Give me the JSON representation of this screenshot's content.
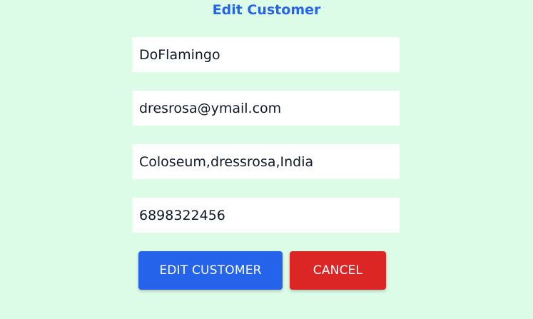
{
  "form": {
    "title": "Edit Customer",
    "fields": {
      "name": "DoFlamingo",
      "email": "dresrosa@ymail.com",
      "address": "Coloseum,dressrosa,India",
      "phone": "6898322456"
    },
    "buttons": {
      "edit_label": "EDIT CUSTOMER",
      "cancel_label": "CANCEL"
    }
  },
  "colors": {
    "background": "#dcfce7",
    "title": "#2563eb",
    "primary_button": "#2563eb",
    "cancel_button": "#dc2626"
  }
}
